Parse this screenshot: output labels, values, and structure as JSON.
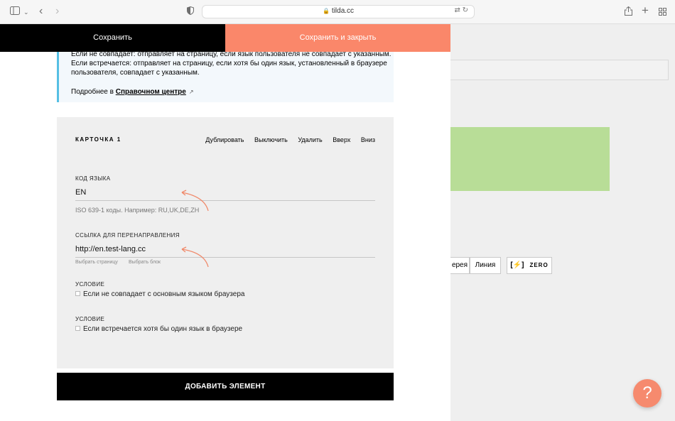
{
  "browser": {
    "url": "tilda.cc"
  },
  "panel": {
    "save_label": "Сохранить",
    "save_close_label": "Сохранить и закрыть",
    "info": {
      "line1": "Если не совпадает: отправляет на страницу, если язык пользователя не совпадает с указанным.",
      "line2": "Если встречается: отправляет на страницу, если хотя бы один язык, установленный в браузере",
      "line3": "пользователя, совпадает с указанным.",
      "more_prefix": "Подробнее в",
      "more_link": "Справочном центре"
    },
    "card": {
      "title": "КАРТОЧКА 1",
      "actions": [
        "Дублировать",
        "Выключить",
        "Удалить",
        "Вверх",
        "Вниз"
      ],
      "lang_label": "КОД ЯЗЫКА",
      "lang_value": "EN",
      "lang_hint": "ISO 639-1 коды. Например: RU,UK,DE,ZH",
      "redirect_label": "ССЫЛКА ДЛЯ ПЕРЕНАПРАВЛЕНИЯ",
      "redirect_value": "http://en.test-lang.cc",
      "choose_page": "Выбрать страницу",
      "choose_block": "Выбрать блок",
      "condition1_label": "УСЛОВИЕ",
      "condition1_text": "Если не совпадает с основным языком браузера",
      "condition2_label": "УСЛОВИЕ",
      "condition2_text": "Если встречается хотя бы один язык в браузере"
    },
    "add_label": "ДОБАВИТЬ ЭЛЕМЕНТ"
  },
  "background": {
    "gallery_label": "ерея",
    "line_label": "Линия",
    "zero_label": "ZERO"
  },
  "colors": {
    "accent": "#fa876a",
    "info_border": "#55bfe4",
    "green_block": "#b8dd97"
  }
}
